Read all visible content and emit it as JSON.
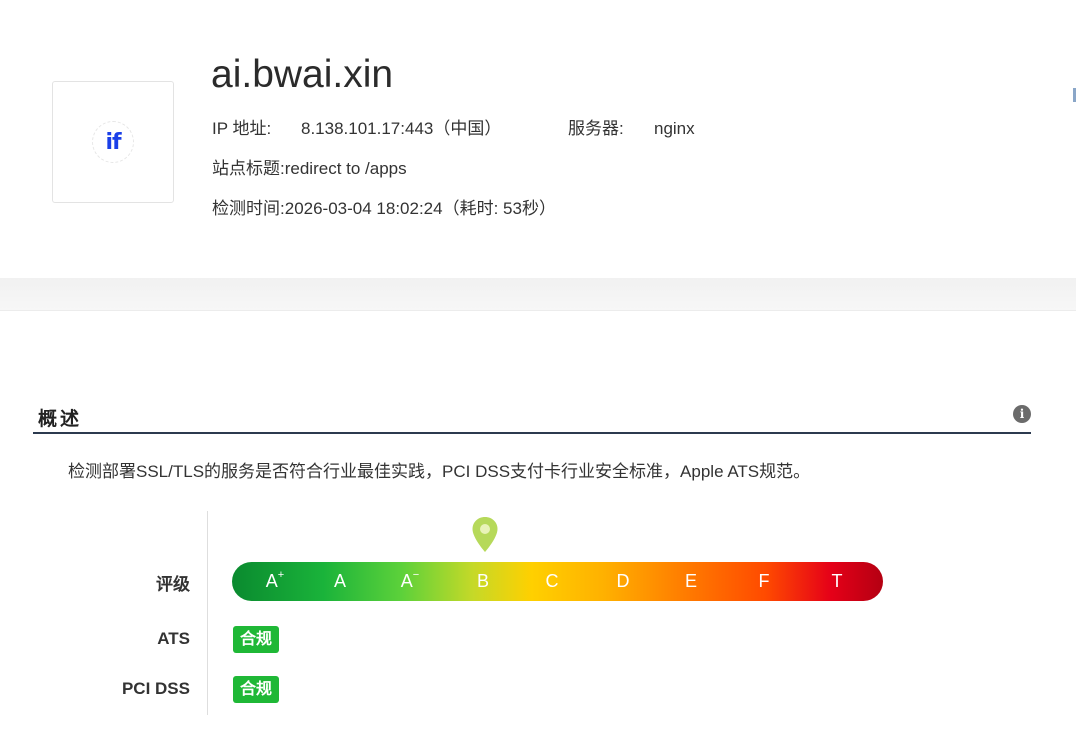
{
  "site": {
    "logo_text": "if",
    "title": "ai.bwai.xin",
    "ip_label": "IP 地址:",
    "ip_value": "8.138.101.17:443（中国）",
    "server_label": "服务器:",
    "server_value": "nginx",
    "site_title_label": "站点标题:",
    "site_title_value": "redirect to /apps",
    "check_time_label": "检测时间:",
    "check_time_value": "2026-03-04 18:02:24（耗时: 53秒）"
  },
  "overview": {
    "title": "概述",
    "info_icon": "info-icon",
    "description": "检测部署SSL/TLS的服务是否符合行业最佳实践，PCI DSS支付卡行业安全标准，Apple ATS规范。",
    "grade_label": "评级",
    "grades": [
      {
        "letter": "A",
        "mark": "+"
      },
      {
        "letter": "A",
        "mark": ""
      },
      {
        "letter": "A",
        "mark": "−"
      },
      {
        "letter": "B",
        "mark": ""
      },
      {
        "letter": "C",
        "mark": ""
      },
      {
        "letter": "D",
        "mark": ""
      },
      {
        "letter": "E",
        "mark": ""
      },
      {
        "letter": "F",
        "mark": ""
      },
      {
        "letter": "T",
        "mark": ""
      }
    ],
    "current_grade": "B",
    "current_grade_index": 3,
    "pin_color": "#b6d95a",
    "ats_label": "ATS",
    "ats_status": "合规",
    "pci_label": "PCI DSS",
    "pci_status": "合规",
    "status_color": "#1fb836"
  }
}
